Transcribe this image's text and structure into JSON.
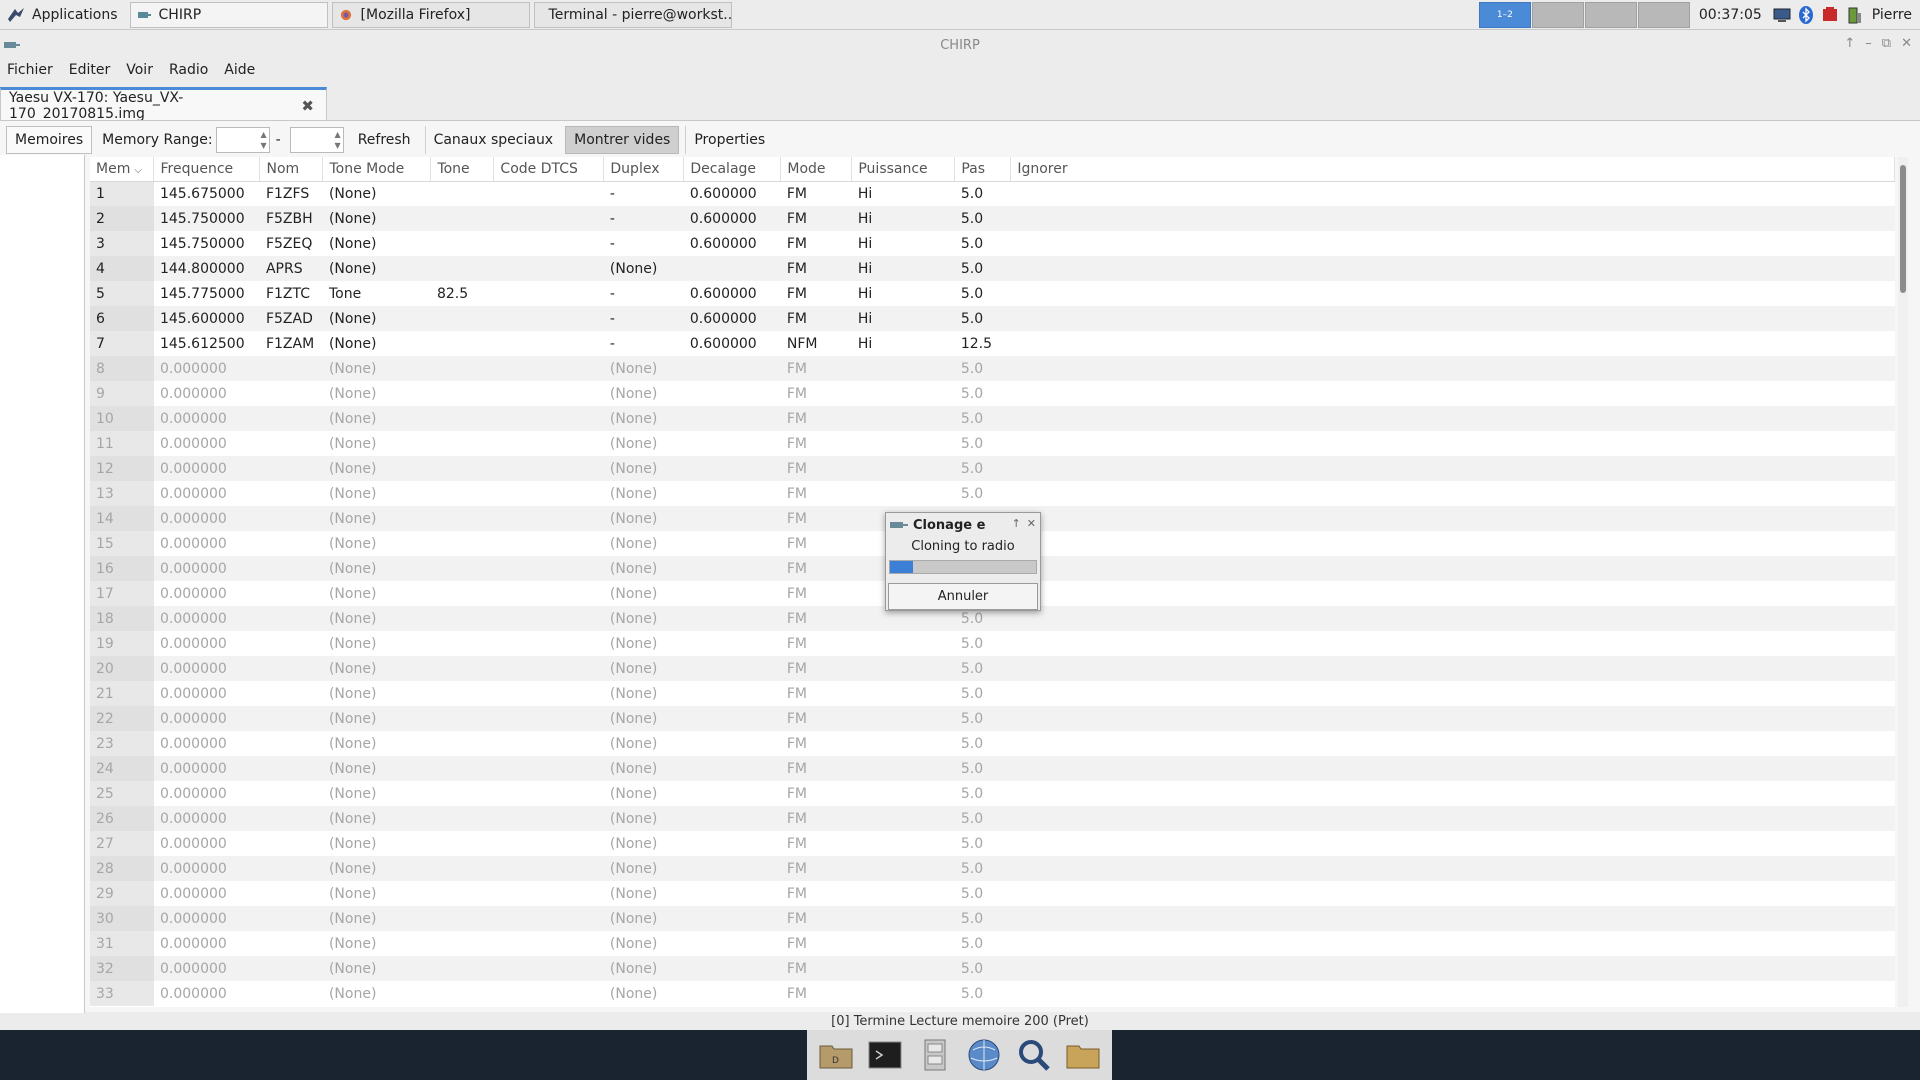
{
  "top_panel": {
    "app_menu_label": "Applications",
    "tasks": [
      {
        "label": "CHIRP",
        "icon": "chirp-icon"
      },
      {
        "label": "[Mozilla Firefox]",
        "icon": "firefox-icon"
      },
      {
        "label": "Terminal - pierre@workst...",
        "icon": "terminal-icon"
      }
    ],
    "workspace_active_label": "1–2",
    "clock": "00:37:05",
    "user": "Pierre"
  },
  "window": {
    "title": "CHIRP",
    "menu": [
      "Fichier",
      "Editer",
      "Voir",
      "Radio",
      "Aide"
    ],
    "tab_label": "Yaesu VX-170: Yaesu_VX-170_20170815.img"
  },
  "toolbar": {
    "memoires_tab": "Memoires",
    "memory_range_label": "Memory Range:",
    "range_dash": "-",
    "refresh": "Refresh",
    "special_channels": "Canaux speciaux",
    "show_empty": "Montrer vides",
    "properties": "Properties"
  },
  "table": {
    "columns": [
      "Mem",
      "Frequence",
      "Nom",
      "Tone Mode",
      "Tone",
      "Code DTCS",
      "Duplex",
      "Decalage",
      "Mode",
      "Puissance",
      "Pas",
      "Ignorer"
    ],
    "rows": [
      [
        "1",
        "145.675000",
        "F1ZFS",
        "(None)",
        "",
        "",
        "-",
        "0.600000",
        "FM",
        "Hi",
        "5.0",
        ""
      ],
      [
        "2",
        "145.750000",
        "F5ZBH",
        "(None)",
        "",
        "",
        "-",
        "0.600000",
        "FM",
        "Hi",
        "5.0",
        ""
      ],
      [
        "3",
        "145.750000",
        "F5ZEQ",
        "(None)",
        "",
        "",
        "-",
        "0.600000",
        "FM",
        "Hi",
        "5.0",
        ""
      ],
      [
        "4",
        "144.800000",
        "APRS",
        "(None)",
        "",
        "",
        "(None)",
        "",
        "FM",
        "Hi",
        "5.0",
        ""
      ],
      [
        "5",
        "145.775000",
        "F1ZTC",
        "Tone",
        "82.5",
        "",
        "-",
        "0.600000",
        "FM",
        "Hi",
        "5.0",
        ""
      ],
      [
        "6",
        "145.600000",
        "F5ZAD",
        "(None)",
        "",
        "",
        "-",
        "0.600000",
        "FM",
        "Hi",
        "5.0",
        ""
      ],
      [
        "7",
        "145.612500",
        "F1ZAM",
        "(None)",
        "",
        "",
        "-",
        "0.600000",
        "NFM",
        "Hi",
        "12.5",
        ""
      ],
      [
        "8",
        "0.000000",
        "",
        "(None)",
        "",
        "",
        "(None)",
        "",
        "FM",
        "",
        "5.0",
        ""
      ],
      [
        "9",
        "0.000000",
        "",
        "(None)",
        "",
        "",
        "(None)",
        "",
        "FM",
        "",
        "5.0",
        ""
      ],
      [
        "10",
        "0.000000",
        "",
        "(None)",
        "",
        "",
        "(None)",
        "",
        "FM",
        "",
        "5.0",
        ""
      ],
      [
        "11",
        "0.000000",
        "",
        "(None)",
        "",
        "",
        "(None)",
        "",
        "FM",
        "",
        "5.0",
        ""
      ],
      [
        "12",
        "0.000000",
        "",
        "(None)",
        "",
        "",
        "(None)",
        "",
        "FM",
        "",
        "5.0",
        ""
      ],
      [
        "13",
        "0.000000",
        "",
        "(None)",
        "",
        "",
        "(None)",
        "",
        "FM",
        "",
        "5.0",
        ""
      ],
      [
        "14",
        "0.000000",
        "",
        "(None)",
        "",
        "",
        "(None)",
        "",
        "FM",
        "",
        "",
        ""
      ],
      [
        "15",
        "0.000000",
        "",
        "(None)",
        "",
        "",
        "(None)",
        "",
        "FM",
        "",
        "",
        ""
      ],
      [
        "16",
        "0.000000",
        "",
        "(None)",
        "",
        "",
        "(None)",
        "",
        "FM",
        "",
        "",
        ""
      ],
      [
        "17",
        "0.000000",
        "",
        "(None)",
        "",
        "",
        "(None)",
        "",
        "FM",
        "",
        "",
        ""
      ],
      [
        "18",
        "0.000000",
        "",
        "(None)",
        "",
        "",
        "(None)",
        "",
        "FM",
        "",
        "5.0",
        ""
      ],
      [
        "19",
        "0.000000",
        "",
        "(None)",
        "",
        "",
        "(None)",
        "",
        "FM",
        "",
        "5.0",
        ""
      ],
      [
        "20",
        "0.000000",
        "",
        "(None)",
        "",
        "",
        "(None)",
        "",
        "FM",
        "",
        "5.0",
        ""
      ],
      [
        "21",
        "0.000000",
        "",
        "(None)",
        "",
        "",
        "(None)",
        "",
        "FM",
        "",
        "5.0",
        ""
      ],
      [
        "22",
        "0.000000",
        "",
        "(None)",
        "",
        "",
        "(None)",
        "",
        "FM",
        "",
        "5.0",
        ""
      ],
      [
        "23",
        "0.000000",
        "",
        "(None)",
        "",
        "",
        "(None)",
        "",
        "FM",
        "",
        "5.0",
        ""
      ],
      [
        "24",
        "0.000000",
        "",
        "(None)",
        "",
        "",
        "(None)",
        "",
        "FM",
        "",
        "5.0",
        ""
      ],
      [
        "25",
        "0.000000",
        "",
        "(None)",
        "",
        "",
        "(None)",
        "",
        "FM",
        "",
        "5.0",
        ""
      ],
      [
        "26",
        "0.000000",
        "",
        "(None)",
        "",
        "",
        "(None)",
        "",
        "FM",
        "",
        "5.0",
        ""
      ],
      [
        "27",
        "0.000000",
        "",
        "(None)",
        "",
        "",
        "(None)",
        "",
        "FM",
        "",
        "5.0",
        ""
      ],
      [
        "28",
        "0.000000",
        "",
        "(None)",
        "",
        "",
        "(None)",
        "",
        "FM",
        "",
        "5.0",
        ""
      ],
      [
        "29",
        "0.000000",
        "",
        "(None)",
        "",
        "",
        "(None)",
        "",
        "FM",
        "",
        "5.0",
        ""
      ],
      [
        "30",
        "0.000000",
        "",
        "(None)",
        "",
        "",
        "(None)",
        "",
        "FM",
        "",
        "5.0",
        ""
      ],
      [
        "31",
        "0.000000",
        "",
        "(None)",
        "",
        "",
        "(None)",
        "",
        "FM",
        "",
        "5.0",
        ""
      ],
      [
        "32",
        "0.000000",
        "",
        "(None)",
        "",
        "",
        "(None)",
        "",
        "FM",
        "",
        "5.0",
        ""
      ],
      [
        "33",
        "0.000000",
        "",
        "(None)",
        "",
        "",
        "(None)",
        "",
        "FM",
        "",
        "5.0",
        ""
      ]
    ]
  },
  "status": "[0] Termine Lecture memoire 200 (Pret)",
  "dialog": {
    "title": "Clonage e",
    "message": "Cloning to radio",
    "progress": 0.16,
    "cancel": "Annuler"
  },
  "dock_icons": [
    "home-folder-icon",
    "terminal-icon",
    "file-cabinet-icon",
    "web-browser-icon",
    "search-icon",
    "folder-icon"
  ],
  "colors": {
    "accent": "#4a8ad6",
    "progress": "#3b7fd6",
    "dock_bg": "#1a2330"
  }
}
